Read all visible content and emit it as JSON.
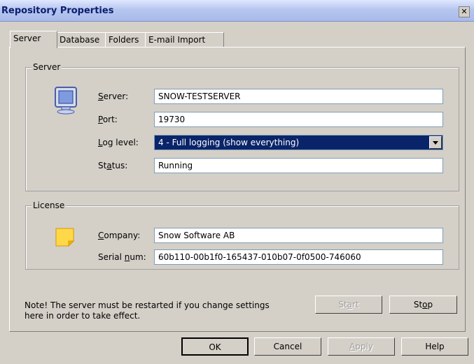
{
  "window": {
    "title": "Repository Properties",
    "close": "✕"
  },
  "tabs": [
    {
      "label": "Server",
      "active": true
    },
    {
      "label": "Database",
      "active": false
    },
    {
      "label": "Folders",
      "active": false
    },
    {
      "label": "E-mail Import",
      "active": false
    }
  ],
  "server": {
    "group_title": "Server",
    "icon": "monitor-icon",
    "server_label_u": "S",
    "server_label_rest": "erver:",
    "server_value": "SNOW-TESTSERVER",
    "port_label_u": "P",
    "port_label_rest": "ort:",
    "port_value": "19730",
    "log_label_u": "L",
    "log_label_rest": "og level:",
    "log_value": "4 - Full logging (show everything)",
    "status_label_a": "St",
    "status_label_u": "a",
    "status_label_rest": "tus:",
    "status_value": "Running"
  },
  "license": {
    "group_title": "License",
    "icon": "sticky-note-icon",
    "company_label_u": "C",
    "company_label_rest": "ompany:",
    "company_value": "Snow Software AB",
    "serial_label_a": "Serial ",
    "serial_label_u": "n",
    "serial_label_rest": "um:",
    "serial_value": "60b110-00b1f0-165437-010b07-0f0500-746060"
  },
  "note": {
    "text": "Note! The server must be restarted if you change settings here in order to take effect."
  },
  "buttons": {
    "start_a": "St",
    "start_u": "a",
    "start_rest": "rt",
    "stop_a": "St",
    "stop_u": "o",
    "stop_rest": "p",
    "ok": "OK",
    "cancel": "Cancel",
    "apply_u": "A",
    "apply_rest": "pply",
    "help": "Help"
  },
  "colors": {
    "selection": "#0a246a",
    "face": "#d4d0c8"
  }
}
